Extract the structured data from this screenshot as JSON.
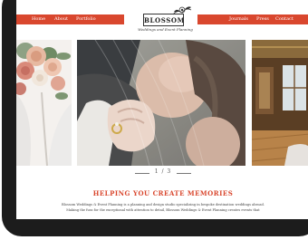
{
  "nav": {
    "left": [
      "Home",
      "About",
      "Portfolio"
    ],
    "right": [
      "Journals",
      "Press",
      "Contact"
    ]
  },
  "brand": {
    "name": "BLOSSOM",
    "tagline": "Weddings and Event Planning"
  },
  "slider": {
    "pager": "1 / 3"
  },
  "content": {
    "heading": "HELPING YOU CREATE MEMORIES",
    "body_line1": "Blossom Weddings & Event Planning is a planning and design studio specializing in bespoke destination weddings abroad.",
    "body_line2": "Making the fuss for the exceptional with attention to detail, Blossom Weddings & Event Planning creates events that"
  },
  "colors": {
    "accent": "#d9472e",
    "device": "#1c1c1c"
  }
}
